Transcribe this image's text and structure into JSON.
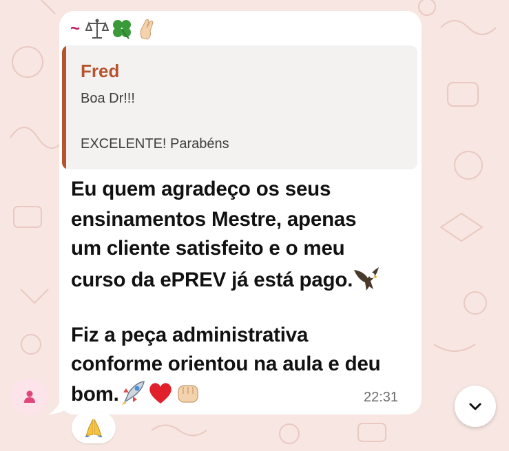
{
  "message": {
    "prefix": "~",
    "sender_emojis": [
      "balance-scale",
      "four-leaf-clover",
      "crossed-fingers"
    ],
    "quote": {
      "author": "Fred",
      "line1": "Boa Dr!!!",
      "line2": "EXCELENTE! Parabéns"
    },
    "paragraph1": [
      "Eu quem agradeço os seus",
      "ensinamentos Mestre, apenas",
      "um cliente satisfeito e o meu",
      "curso da ePREV já está pago."
    ],
    "paragraph2": [
      "Fiz a peça administrativa",
      "conforme orientou na aula e deu",
      "bom."
    ],
    "trailing_emojis_1": [
      "eagle"
    ],
    "trailing_emojis_2": [
      "rocket",
      "red-heart",
      "fist"
    ],
    "time": "22:31",
    "reaction": "folded-hands"
  },
  "colors": {
    "wallpaper": "#f7e6e1",
    "quote_accent": "#b6542f",
    "avatar_bg": "#fde4ea",
    "avatar_icon": "#e0457b"
  }
}
